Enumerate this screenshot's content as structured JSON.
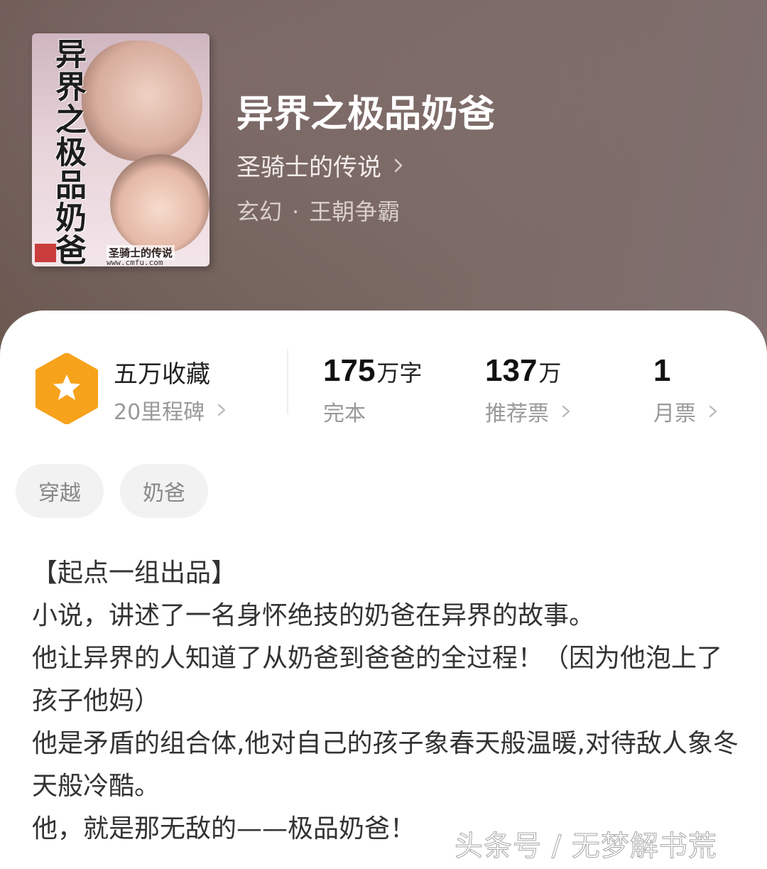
{
  "header": {
    "book_title": "异界之极品奶爸",
    "author": "圣骑士的传说",
    "genre_main": "玄幻",
    "genre_separator": "·",
    "genre_sub": "王朝争霸",
    "cover": {
      "title_text": "异界之极品奶爸",
      "author_text": "圣骑士的传说",
      "url_text": "www.cmfu.com"
    }
  },
  "stats": {
    "collection": {
      "title": "五万收藏",
      "subtitle": "20里程碑"
    },
    "words": {
      "number": "175",
      "unit": "万字",
      "label": "完本"
    },
    "recommend": {
      "number": "137",
      "unit": "万",
      "label": "推荐票"
    },
    "monthly": {
      "number": "1",
      "label": "月票"
    }
  },
  "tags": [
    "穿越",
    "奶爸"
  ],
  "description": [
    "【起点一组出品】",
    "小说，讲述了一名身怀绝技的奶爸在异界的故事。",
    "他让异界的人知道了从奶爸到爸爸的全过程！（因为他泡上了孩子他妈）",
    "他是矛盾的组合体,他对自己的孩子象春天般温暖,对待敌人象冬天般冷酷。",
    "他，就是那无敌的——极品奶爸！"
  ],
  "watermark": "头条号 / 无梦解书荒",
  "colors": {
    "badge_orange": "#f7a21b",
    "header_bg": "#75635d",
    "muted_text": "#999999"
  }
}
